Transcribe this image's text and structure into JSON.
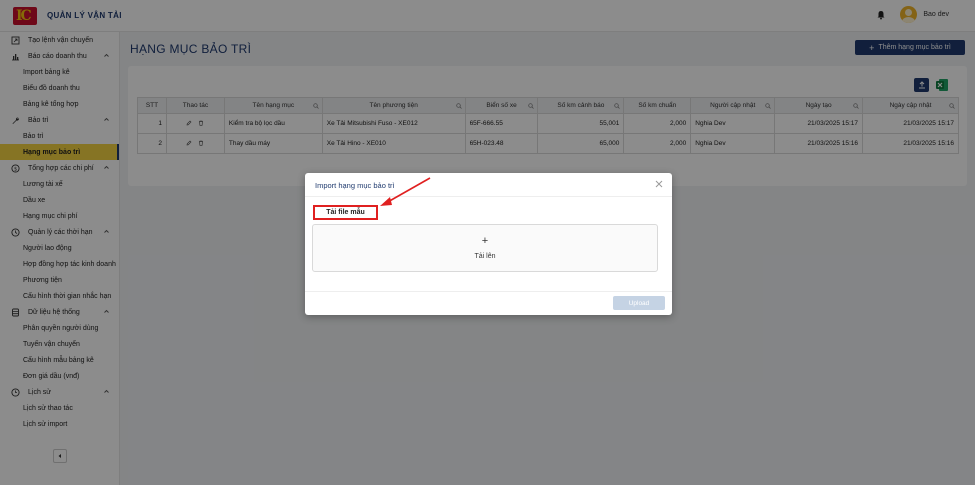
{
  "header": {
    "app_title": "QUẢN LÝ VẬN TẢI",
    "user_name": "Bao dev"
  },
  "sidebar": {
    "groups": [
      {
        "label": "Tạo lệnh vận chuyển",
        "icon": "square-arrow-icon",
        "items": []
      },
      {
        "label": "Báo cáo doanh thu",
        "icon": "bar-chart-icon",
        "items": [
          "Import bảng kê",
          "Biểu đồ doanh thu",
          "Bảng kê tổng hợp"
        ]
      },
      {
        "label": "Bảo trì",
        "icon": "wrench-icon",
        "items": [
          "Bảo trì",
          "Hạng mục bảo trì"
        ]
      },
      {
        "label": "Tổng hợp các chi phí",
        "icon": "dollar-icon",
        "items": [
          "Lương tài xế",
          "Dầu xe",
          "Hạng mục chi phí"
        ]
      },
      {
        "label": "Quản lý các thời hạn",
        "icon": "clock-icon",
        "items": [
          "Người lao động",
          "Hợp đồng hợp tác kinh doanh",
          "Phương tiện",
          "Cấu hình thời gian nhắc hạn"
        ]
      },
      {
        "label": "Dữ liệu hệ thống",
        "icon": "database-icon",
        "items": [
          "Phân quyền người dùng",
          "Tuyến vận chuyển",
          "Cấu hình mẫu bảng kê",
          "Đơn giá dầu (vnđ)"
        ]
      },
      {
        "label": "Lịch sử",
        "icon": "history-icon",
        "items": [
          "Lịch sử thao tác",
          "Lịch sử import"
        ]
      }
    ],
    "active_item": "Hạng mục bảo trì"
  },
  "main": {
    "page_title": "HẠNG MỤC BẢO TRÌ",
    "add_button": "Thêm hạng mục bảo trì",
    "table": {
      "columns": [
        "STT",
        "Thao tác",
        "Tên hạng mục",
        "Tên phương tiện",
        "Biển số xe",
        "Số km cảnh báo",
        "Số km chuẩn",
        "Người cập nhật",
        "Ngày tạo",
        "Ngày cập nhật"
      ],
      "rows": [
        {
          "stt": "1",
          "name": "Kiểm tra bộ lọc dầu",
          "vehicle": "Xe Tải Mitsubishi Fuso - XE012",
          "plate": "65F-666.55",
          "warn_km": "55,001",
          "std_km": "2,000",
          "updater": "Nghia Dev",
          "created": "21/03/2025 15:17",
          "updated": "21/03/2025 15:17"
        },
        {
          "stt": "2",
          "name": "Thay dầu máy",
          "vehicle": "Xe Tải Hino - XE010",
          "plate": "65H-023.48",
          "warn_km": "65,000",
          "std_km": "2,000",
          "updater": "Nghia Dev",
          "created": "21/03/2025 15:16",
          "updated": "21/03/2025 15:16"
        }
      ]
    }
  },
  "modal": {
    "title": "Import hạng mục bảo trì",
    "template_link": "Tải file mẫu",
    "dropzone_plus": "+",
    "dropzone_label": "Tải lên",
    "upload_button": "Upload"
  },
  "colors": {
    "primary": "#1f3a6e",
    "active_bg": "#f5d442",
    "highlight_red": "#e02020"
  }
}
